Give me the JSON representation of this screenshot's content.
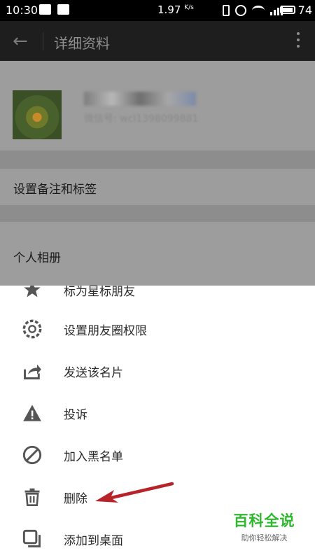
{
  "status_bar": {
    "time": "10:30",
    "speed": "1.97",
    "speed_unit": "K/s",
    "battery": "74"
  },
  "titlebar": {
    "title": "详细资料"
  },
  "profile": {
    "wechat_id": "微信号: wcl1398099881"
  },
  "rows": {
    "remark_label": "设置备注和标签",
    "album_label": "个人相册"
  },
  "sheet": {
    "items": [
      {
        "label": "标为星标朋友",
        "icon": "star-icon"
      },
      {
        "label": "设置朋友圈权限",
        "icon": "aperture-icon"
      },
      {
        "label": "发送该名片",
        "icon": "share-icon"
      },
      {
        "label": "投诉",
        "icon": "warning-icon"
      },
      {
        "label": "加入黑名单",
        "icon": "block-icon"
      },
      {
        "label": "删除",
        "icon": "trash-icon"
      },
      {
        "label": "添加到桌面",
        "icon": "add-to-desktop-icon"
      }
    ]
  },
  "watermark": {
    "title": "百科全说",
    "subtitle": "助你轻松解决"
  },
  "colors": {
    "accent_arrow": "#b8232a",
    "watermark_green": "#2db82d"
  }
}
